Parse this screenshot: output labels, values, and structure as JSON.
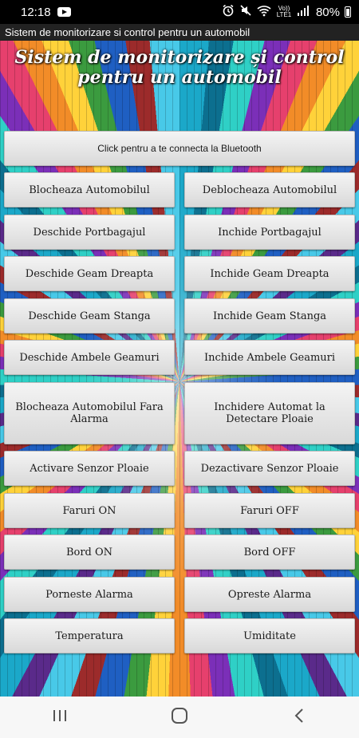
{
  "status_bar": {
    "time": "12:18",
    "network_label": "Vo)) LTE1",
    "battery": "80%"
  },
  "window": {
    "title": "Sistem de monitorizare si control pentru un automobil"
  },
  "app": {
    "title": "Sistem de monitorizare și control pentru un automobil"
  },
  "buttons": {
    "bluetooth": "Click pentru a te connecta la Bluetooth",
    "rows": [
      {
        "left": "Blocheaza Automobilul",
        "right": "Deblocheaza Automobilul"
      },
      {
        "left": "Deschide Portbagajul",
        "right": "Inchide Portbagajul"
      },
      {
        "left": "Deschide Geam Dreapta",
        "right": "Inchide Geam Dreapta"
      },
      {
        "left": "Deschide Geam Stanga",
        "right": "Inchide Geam Stanga"
      },
      {
        "left": "Deschide Ambele Geamuri",
        "right": "Inchide Ambele Geamuri"
      },
      {
        "left": "Blocheaza Automobilul Fara Alarma",
        "right": "Inchidere Automat la Detectare Ploaie"
      },
      {
        "left": "Activare Senzor Ploaie",
        "right": "Dezactivare Senzor Ploaie"
      },
      {
        "left": "Faruri ON",
        "right": "Faruri OFF"
      },
      {
        "left": "Bord ON",
        "right": "Bord OFF"
      },
      {
        "left": "Porneste Alarma",
        "right": "Opreste Alarma"
      },
      {
        "left": "Temperatura",
        "right": "Umiditate"
      }
    ]
  },
  "icons": {
    "status": [
      "youtube-icon",
      "alarm-icon",
      "mute-icon",
      "wifi-icon",
      "signal-icon",
      "battery-icon"
    ],
    "nav": [
      "recent-apps-icon",
      "home-icon",
      "back-icon"
    ]
  },
  "colors": {
    "button_bg": "#e6e6e6",
    "title_text": "#ffffff",
    "status_bar_bg": "#000000",
    "nav_bar_bg": "#f7f7f7"
  }
}
